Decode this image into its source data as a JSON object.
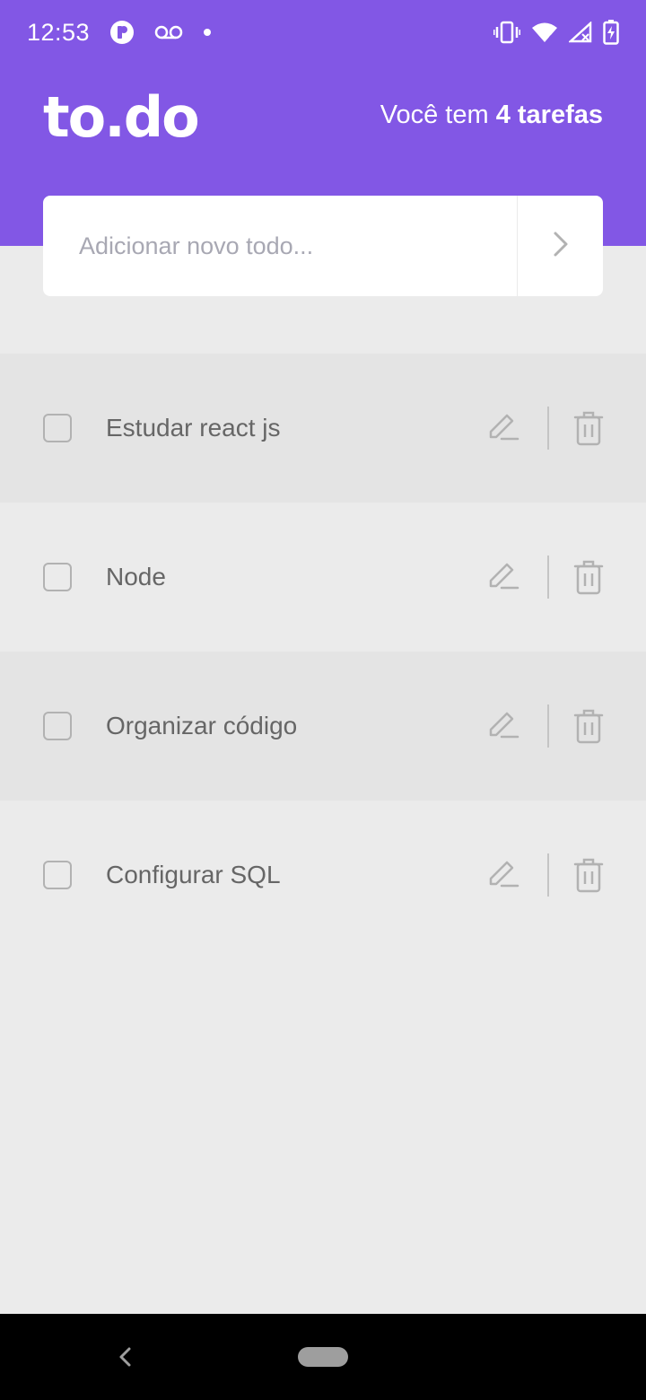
{
  "status_bar": {
    "time": "12:53",
    "icons_left": [
      "app-icon",
      "voicemail-icon",
      "dot-icon"
    ],
    "icons_right": [
      "vibrate-icon",
      "wifi-icon",
      "signal-icon",
      "battery-icon"
    ]
  },
  "header": {
    "logo": "to.do",
    "count_prefix": "Você tem ",
    "count_strong": "4 tarefas",
    "background": "#8257e5"
  },
  "input": {
    "placeholder": "Adicionar novo todo...",
    "value": "",
    "submit_icon": "chevron-right-icon"
  },
  "tasks": [
    {
      "label": "Estudar react js",
      "done": false
    },
    {
      "label": "Node",
      "done": false
    },
    {
      "label": "Organizar código",
      "done": false
    },
    {
      "label": "Configurar SQL",
      "done": false
    }
  ],
  "colors": {
    "accent": "#8257e5",
    "background": "#ebebeb",
    "text": "#666666"
  }
}
